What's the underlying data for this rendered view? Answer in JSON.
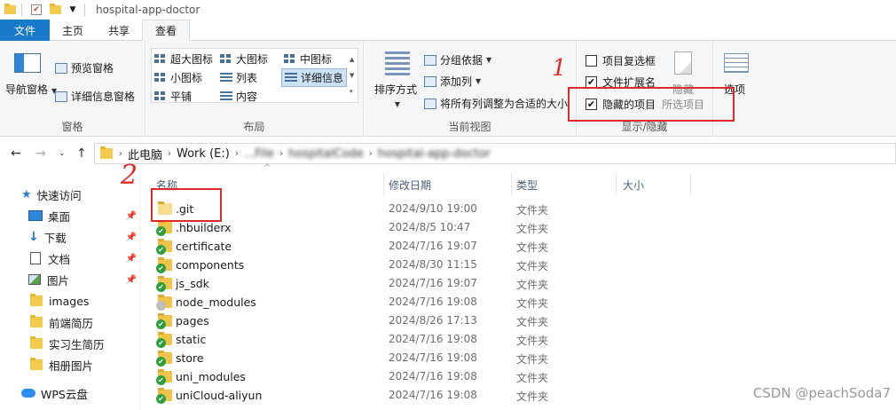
{
  "window": {
    "title": "hospital-app-doctor"
  },
  "tabs": [
    "文件",
    "主页",
    "共享",
    "查看"
  ],
  "ribbon": {
    "pane_group": {
      "label": "窗格",
      "nav_pane": "导航窗格",
      "preview_pane": "预览窗格",
      "details_pane": "详细信息窗格"
    },
    "layout_group": {
      "label": "布局",
      "items": [
        "超大图标",
        "大图标",
        "中图标",
        "小图标",
        "列表",
        "详细信息",
        "平铺",
        "内容"
      ]
    },
    "current_view_group": {
      "label": "当前视图",
      "sort_by": "排序方式",
      "group_by": "分组依据",
      "add_column": "添加列",
      "fit_columns": "将所有列调整为合适的大小"
    },
    "show_hide_group": {
      "label": "显示/隐藏",
      "item_checkboxes": "项目复选框",
      "file_extensions": "文件扩展名",
      "hidden_items": "隐藏的项目",
      "hide_selected": "隐藏",
      "hide_selected_sub": "所选项目"
    },
    "options_label": "选项"
  },
  "address": {
    "crumbs": [
      "此电脑",
      "Work (E:)",
      "...File",
      "hospitalCode",
      "hospital-app-doctor"
    ]
  },
  "nav": {
    "quick_access": "快速访问",
    "items": [
      {
        "label": "桌面",
        "pinned": true
      },
      {
        "label": "下载",
        "pinned": true
      },
      {
        "label": "文档",
        "pinned": true
      },
      {
        "label": "图片",
        "pinned": true
      },
      {
        "label": "images",
        "pinned": false
      },
      {
        "label": "前端简历",
        "pinned": false
      },
      {
        "label": "实习生简历",
        "pinned": false
      },
      {
        "label": "相册图片",
        "pinned": false
      }
    ],
    "wps": "WPS云盘"
  },
  "columns": {
    "name": "名称",
    "modified": "修改日期",
    "type": "类型",
    "size": "大小"
  },
  "files": [
    {
      "name": ".git",
      "modified": "2024/9/10 19:00",
      "type": "文件夹",
      "status": "none"
    },
    {
      "name": ".hbuilderx",
      "modified": "2024/8/5 10:47",
      "type": "文件夹",
      "status": "synced"
    },
    {
      "name": "certificate",
      "modified": "2024/7/16 19:07",
      "type": "文件夹",
      "status": "synced"
    },
    {
      "name": "components",
      "modified": "2024/8/30 11:15",
      "type": "文件夹",
      "status": "synced"
    },
    {
      "name": "js_sdk",
      "modified": "2024/7/16 19:07",
      "type": "文件夹",
      "status": "synced"
    },
    {
      "name": "node_modules",
      "modified": "2024/7/16 19:08",
      "type": "文件夹",
      "status": "ignored"
    },
    {
      "name": "pages",
      "modified": "2024/8/26 17:13",
      "type": "文件夹",
      "status": "synced"
    },
    {
      "name": "static",
      "modified": "2024/7/16 19:08",
      "type": "文件夹",
      "status": "synced"
    },
    {
      "name": "store",
      "modified": "2024/7/16 19:08",
      "type": "文件夹",
      "status": "synced"
    },
    {
      "name": "uni_modules",
      "modified": "2024/7/16 19:08",
      "type": "文件夹",
      "status": "synced"
    },
    {
      "name": "uniCloud-aliyun",
      "modified": "2024/7/16 19:08",
      "type": "文件夹",
      "status": "synced"
    }
  ],
  "annotations": {
    "mark_1": "1",
    "mark_2": "2"
  },
  "watermark": "CSDN @peachSoda7"
}
